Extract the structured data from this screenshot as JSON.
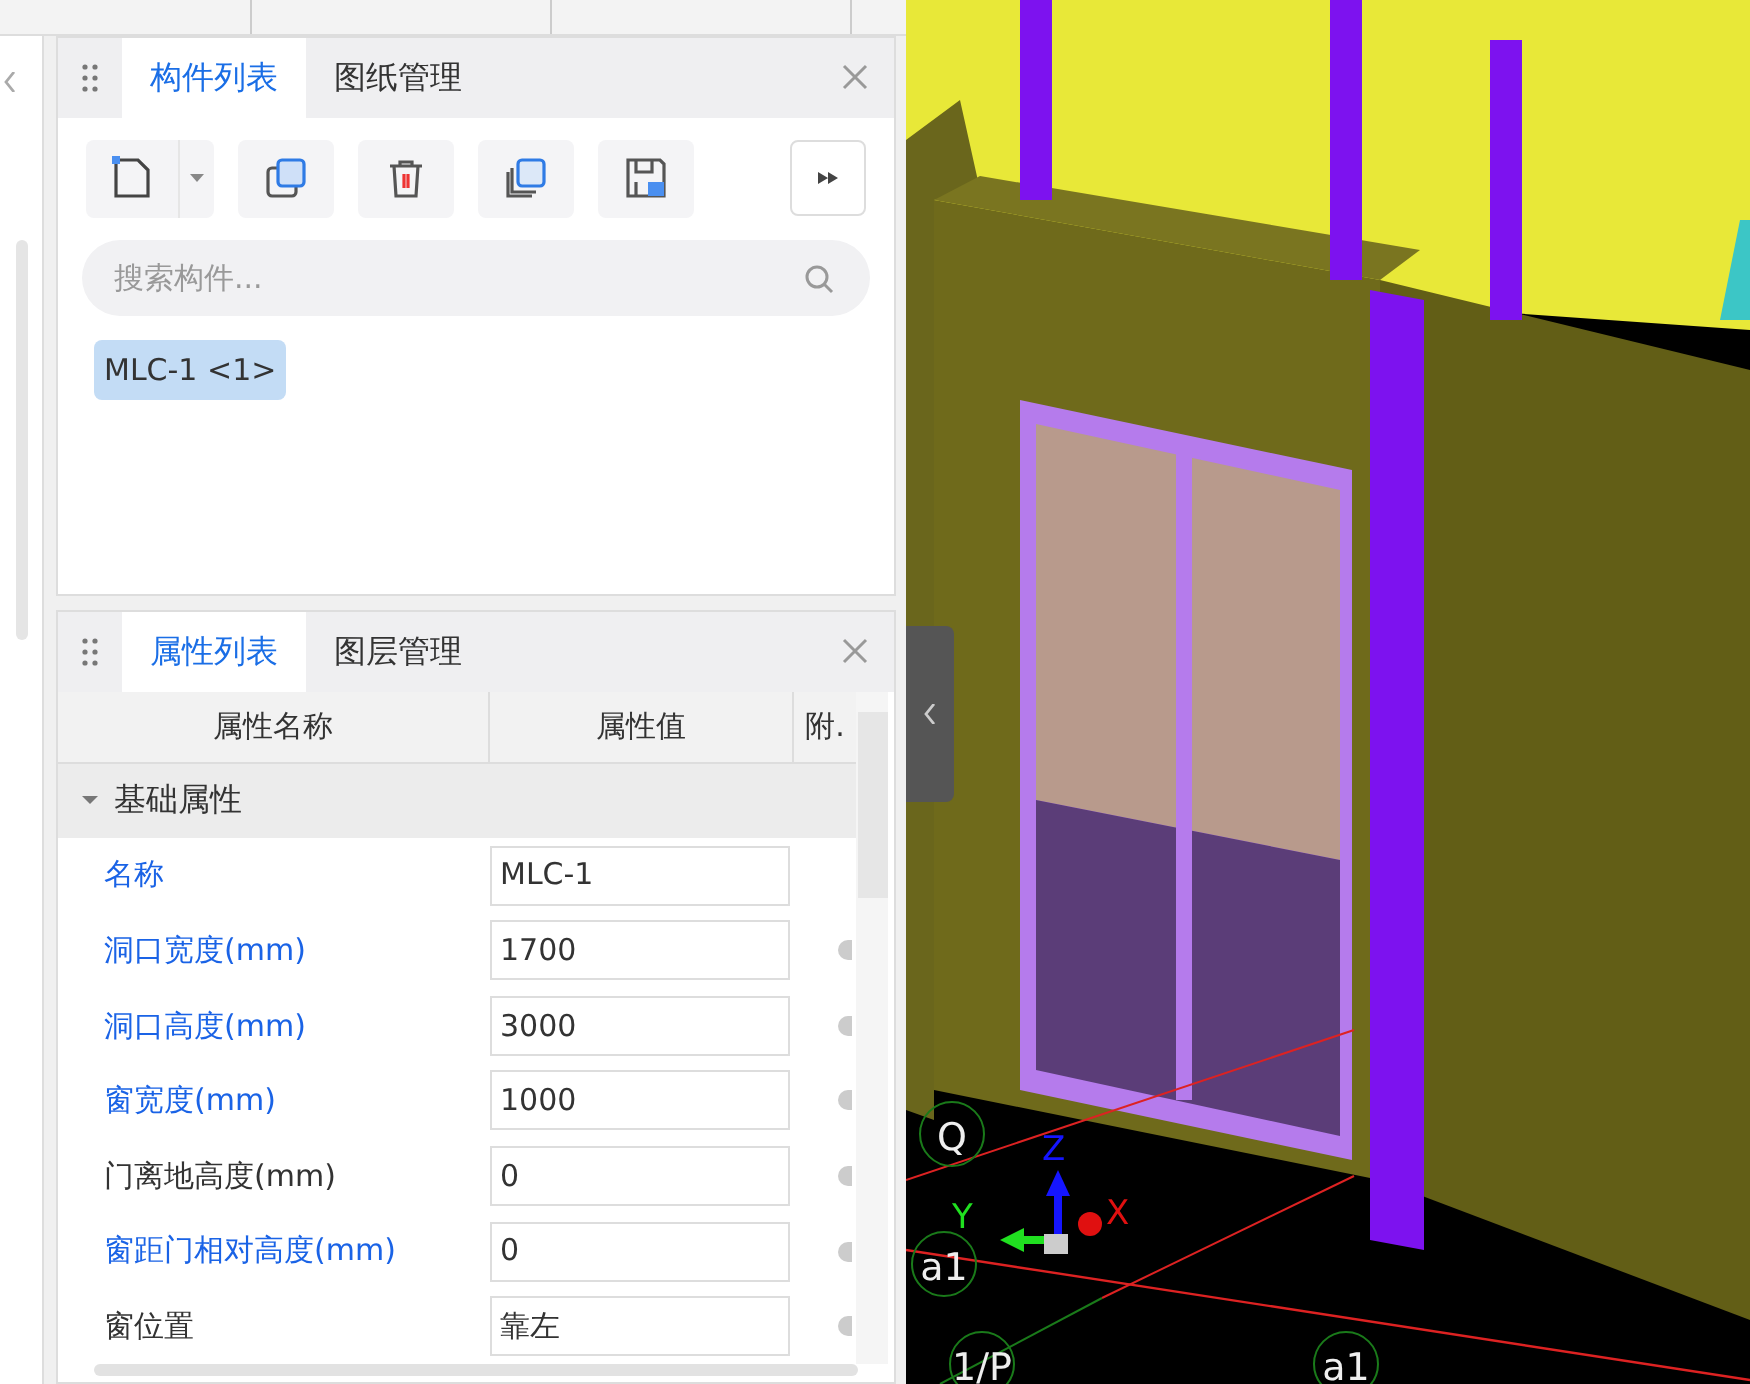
{
  "component_panel": {
    "tabs": [
      {
        "label": "构件列表",
        "selected": true
      },
      {
        "label": "图纸管理",
        "selected": false
      }
    ],
    "search": {
      "placeholder": "搜索构件..."
    },
    "items": [
      {
        "label": "MLC-1 <1>",
        "selected": true
      }
    ]
  },
  "property_panel": {
    "tabs": [
      {
        "label": "属性列表",
        "selected": true
      },
      {
        "label": "图层管理",
        "selected": false
      }
    ],
    "columns": [
      "属性名称",
      "属性值",
      "附."
    ],
    "group": {
      "label": "基础属性",
      "expanded": true
    },
    "rows": [
      {
        "name": "名称",
        "value": "MLC-1",
        "color": "#1a63e6"
      },
      {
        "name": "洞口宽度(mm)",
        "value": "1700",
        "color": "#1a63e6"
      },
      {
        "name": "洞口高度(mm)",
        "value": "3000",
        "color": "#1a63e6"
      },
      {
        "name": "窗宽度(mm)",
        "value": "1000",
        "color": "#1a63e6"
      },
      {
        "name": "门离地高度(mm)",
        "value": "0",
        "color": "#333333"
      },
      {
        "name": "窗距门相对高度(mm)",
        "value": "0",
        "color": "#1a63e6"
      },
      {
        "name": "窗位置",
        "value": "靠左",
        "color": "#333333"
      }
    ]
  },
  "viewport": {
    "axis_labels": [
      "Z",
      "Y",
      "X"
    ],
    "grid_labels": [
      "Q",
      "a1",
      "1/P",
      "a1"
    ]
  }
}
